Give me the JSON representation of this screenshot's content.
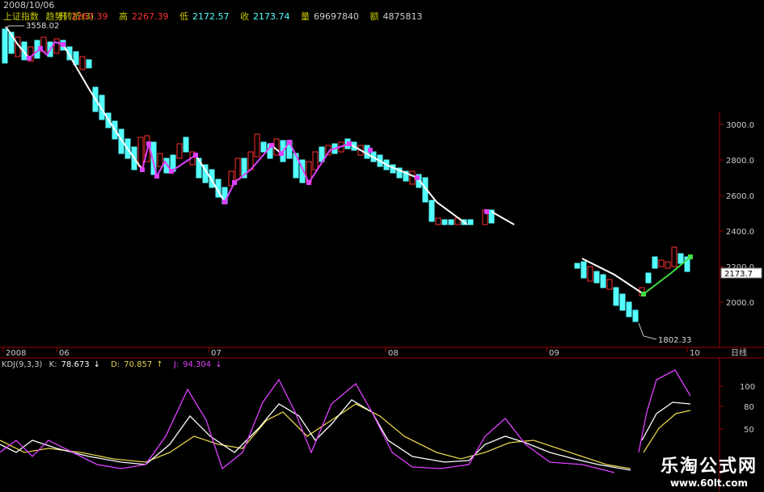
{
  "window": {
    "index_name": "上证指数",
    "indicator_name": "趋势转折(3)"
  },
  "ohlc_header": {
    "date": "2008/10/06",
    "open_label": "开",
    "open": "2267.39",
    "high_label": "高",
    "high": "2267.39",
    "low_label": "低",
    "low": "2172.57",
    "close_label": "收",
    "close": "2173.74",
    "volume_label": "量",
    "volume": "69697840",
    "amount_label": "额",
    "amount": "4875813",
    "down_arrow": "↓"
  },
  "price_panel": {
    "y_ticks": [
      "3000.0",
      "2800.0",
      "2600.0",
      "2400.0",
      "2200.0",
      "2000.0"
    ],
    "current_price": "2173.7",
    "annotations": {
      "high": "3558.02",
      "low": "1802.33"
    },
    "x_labels": [
      "2008",
      "06",
      "07",
      "08",
      "09",
      "10"
    ],
    "period_label": "日线"
  },
  "kdj_panel": {
    "name": "KDJ(9,3,3)",
    "k_label": "K:",
    "k": "78.673",
    "k_arrow": "↓",
    "d_label": "D:",
    "d": "70.857",
    "d_arrow": "↑",
    "j_label": "J:",
    "j": "94.304",
    "j_arrow": "↓",
    "y_ticks": [
      "100",
      "80",
      "50"
    ]
  },
  "watermark": {
    "title": "乐淘公式网",
    "url": "www.60lt.com"
  },
  "colors": {
    "up": "#ff3030",
    "down": "#54ffff",
    "trend_up": "#e040ff",
    "trend_down": "#ffffff",
    "trend_green": "#40e040",
    "k_line": "#ffffff",
    "d_line": "#e6d24a",
    "j_line": "#e040ff",
    "axis": "#a00000",
    "header_label": "#c8c800"
  }
}
